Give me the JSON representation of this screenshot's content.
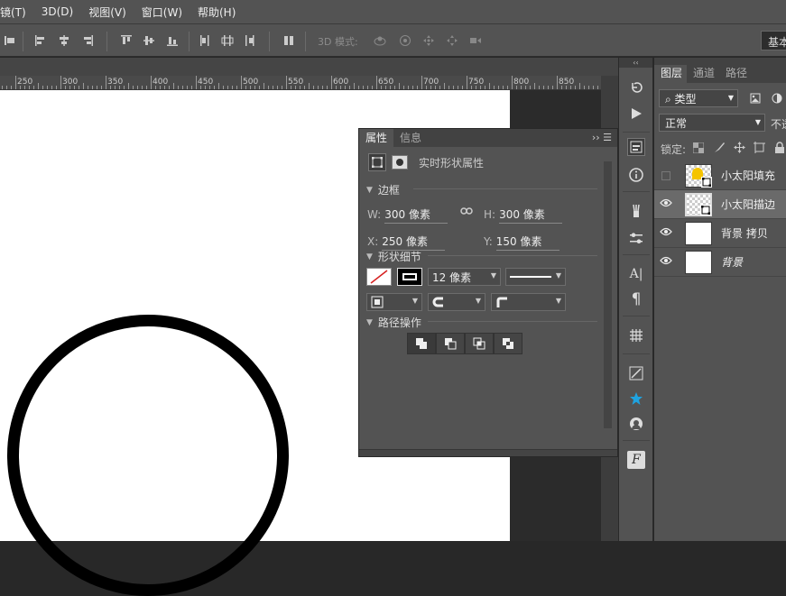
{
  "menu": [
    "镜(T)",
    "3D(D)",
    "视图(V)",
    "窗口(W)",
    "帮助(H)"
  ],
  "toolbar": {
    "mode_3d_label": "3D 模式:",
    "workspace": "基本"
  },
  "ruler": {
    "labels": [
      "250",
      "300",
      "350",
      "400",
      "450",
      "500",
      "550",
      "600",
      "650",
      "700",
      "750",
      "800",
      "850"
    ]
  },
  "properties": {
    "tabs": [
      "属性",
      "信息"
    ],
    "title": "实时形状属性",
    "section_bounds": "边框",
    "w_label": "W:",
    "w_value": "300 像素",
    "h_label": "H:",
    "h_value": "300 像素",
    "x_label": "X:",
    "x_value": "250 像素",
    "y_label": "Y:",
    "y_value": "150 像素",
    "section_shape": "形状细节",
    "stroke_width": "12 像素",
    "section_path": "路径操作"
  },
  "layers_panel": {
    "tabs": [
      "图层",
      "通道",
      "路径"
    ],
    "filter": "类型",
    "blend_mode": "正常",
    "opacity_label": "不透",
    "lock_label": "锁定:",
    "layers": [
      {
        "name": "小太阳填充",
        "visible": false,
        "selected": false
      },
      {
        "name": "小太阳描边",
        "visible": true,
        "selected": true
      },
      {
        "name": "背景 拷贝",
        "visible": true,
        "selected": false
      },
      {
        "name": "背景",
        "visible": true,
        "selected": false
      }
    ]
  },
  "colors": {
    "accent": "#1fa3e0",
    "fill_icon": "#f5c400",
    "stroke_swatch": "#d62020"
  }
}
